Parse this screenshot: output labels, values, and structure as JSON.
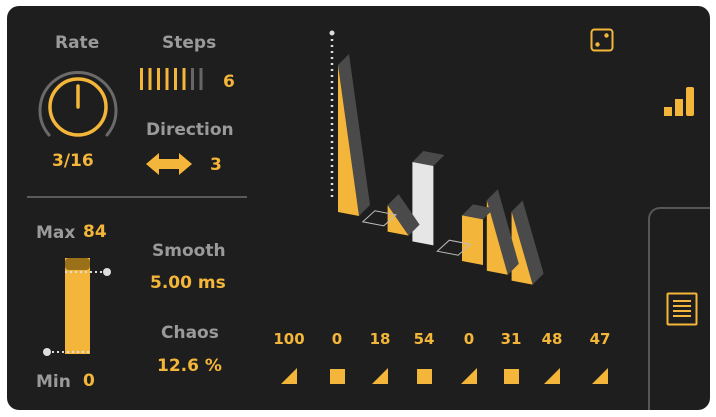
{
  "rate": {
    "label": "Rate",
    "value": "3/16",
    "knob_fraction": 0.5
  },
  "steps": {
    "label": "Steps",
    "value": "6",
    "total_ticks": 8,
    "active_ticks": 6
  },
  "direction": {
    "label": "Direction",
    "value": "3"
  },
  "range": {
    "max_label": "Max",
    "max_value": "84",
    "min_label": "Min",
    "min_value": "0"
  },
  "smooth": {
    "label": "Smooth",
    "value": "5.00 ms"
  },
  "chaos": {
    "label": "Chaos",
    "value": "12.6 %"
  },
  "sequence": {
    "values": [
      "100",
      "0",
      "18",
      "54",
      "0",
      "31",
      "48",
      "47"
    ],
    "shapes": [
      "ramp",
      "square",
      "ramp",
      "square",
      "ramp",
      "square",
      "ramp",
      "ramp"
    ]
  },
  "icons": {
    "dice": "dice-icon",
    "bars": "bars-icon",
    "list": "list-icon",
    "direction": "double-arrow-icon"
  },
  "colors": {
    "background": "#1e1e1e",
    "accent": "#f4b63a",
    "label": "#9a9a9a",
    "highlight": "#e6e6e6",
    "shadow": "#4a4a4a"
  }
}
